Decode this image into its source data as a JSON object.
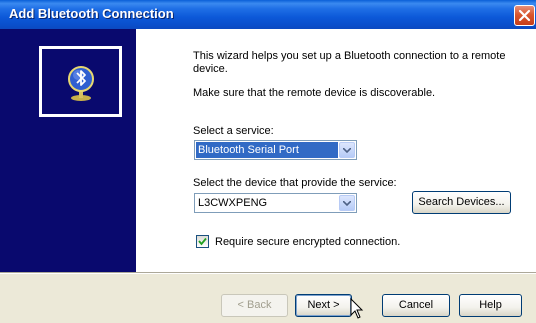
{
  "window": {
    "title": "Add Bluetooth Connection",
    "close_icon": "close-icon"
  },
  "side_panel": {
    "icon": "bluetooth-globe-icon"
  },
  "intro": {
    "line1": "This wizard helps you set up a Bluetooth connection to a remote device.",
    "line2": "Make sure that the remote device is discoverable."
  },
  "service": {
    "label": "Select a service:",
    "selected": "Bluetooth Serial Port"
  },
  "device": {
    "label": "Select the device that provide the service:",
    "selected": "L3CWXPENG",
    "search_button": "Search Devices..."
  },
  "secure": {
    "label": "Require secure encrypted connection.",
    "checked": true
  },
  "buttons": {
    "back": "< Back",
    "next": "Next >",
    "cancel": "Cancel",
    "help": "Help"
  },
  "colors": {
    "titlebar": "#0a4fcc",
    "side_panel": "#09096e",
    "selection": "#316ac5"
  }
}
